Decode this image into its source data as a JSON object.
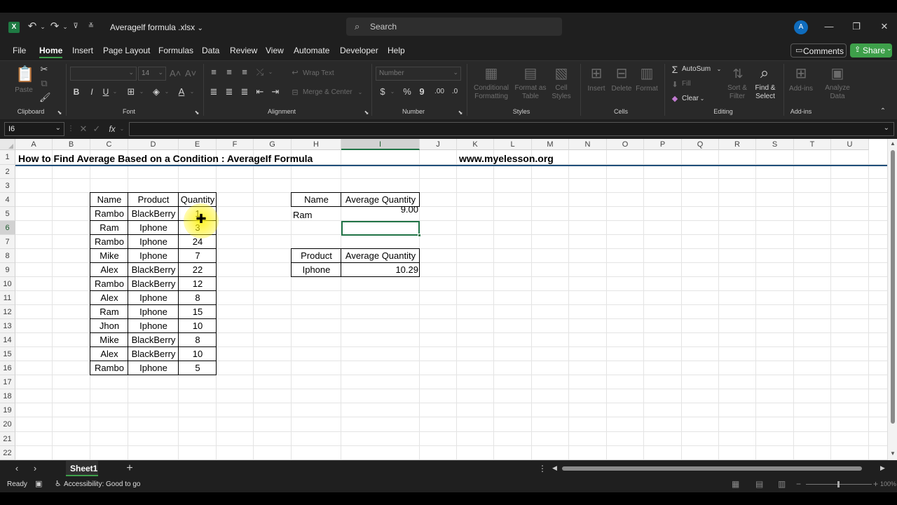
{
  "titlebar": {
    "filename": "Averagelf formula .xlsx",
    "search_placeholder": "Search",
    "avatar_letter": "A"
  },
  "menu": {
    "tabs": [
      "File",
      "Home",
      "Insert",
      "Page Layout",
      "Formulas",
      "Data",
      "Review",
      "View",
      "Automate",
      "Developer",
      "Help"
    ],
    "active": "Home",
    "comments_label": "Comments",
    "share_label": "Share"
  },
  "ribbon": {
    "clipboard": {
      "paste": "Paste",
      "group": "Clipboard"
    },
    "font": {
      "name": "",
      "size": "14",
      "group": "Font"
    },
    "alignment": {
      "wrap": "Wrap Text",
      "merge": "Merge & Center",
      "group": "Alignment"
    },
    "number": {
      "format": "Number",
      "group": "Number"
    },
    "styles": {
      "conditional": "Conditional Formatting",
      "format_table": "Format as Table",
      "cell_styles": "Cell Styles",
      "group": "Styles"
    },
    "cells": {
      "insert": "Insert",
      "delete": "Delete",
      "format": "Format",
      "group": "Cells"
    },
    "editing": {
      "autosum": "AutoSum",
      "fill": "Fill",
      "clear": "Clear",
      "sort": "Sort & Filter",
      "find": "Find & Select",
      "group": "Editing"
    },
    "addins": {
      "addins": "Add-ins",
      "analyze": "Analyze Data",
      "group": "Add-ins"
    }
  },
  "formula_bar": {
    "name_box": "I6",
    "fx": "fx",
    "content": ""
  },
  "grid": {
    "columns": [
      "A",
      "B",
      "C",
      "D",
      "E",
      "F",
      "G",
      "H",
      "I",
      "J",
      "K",
      "L",
      "M",
      "N",
      "O",
      "P",
      "Q",
      "R",
      "S",
      "T",
      "U"
    ],
    "rows": [
      "1",
      "2",
      "3",
      "4",
      "5",
      "6",
      "7",
      "8",
      "9",
      "10",
      "11",
      "12",
      "13",
      "14",
      "15",
      "16",
      "17",
      "18",
      "19",
      "20",
      "21",
      "22"
    ],
    "selected_column": "I",
    "selected_row": "6",
    "title": "How to Find Average Based on a Condition : AverageIf Formula",
    "website": "www.myelesson.org",
    "table_headers": [
      "Name",
      "Product",
      "Quantity"
    ],
    "table_rows": [
      [
        "Rambo",
        "BlackBerry",
        "1"
      ],
      [
        "Ram",
        "Iphone",
        "3"
      ],
      [
        "Rambo",
        "Iphone",
        "24"
      ],
      [
        "Mike",
        "Iphone",
        "7"
      ],
      [
        "Alex",
        "BlackBerry",
        "22"
      ],
      [
        "Rambo",
        "BlackBerry",
        "12"
      ],
      [
        "Alex",
        "Iphone",
        "8"
      ],
      [
        "Ram",
        "Iphone",
        "15"
      ],
      [
        "Jhon",
        "Iphone",
        "10"
      ],
      [
        "Mike",
        "BlackBerry",
        "8"
      ],
      [
        "Alex",
        "BlackBerry",
        "10"
      ],
      [
        "Rambo",
        "Iphone",
        "5"
      ]
    ],
    "avg_name": {
      "header_left": "Name",
      "header_right": "Average Quantity",
      "name": "Ram",
      "value": "9.00"
    },
    "avg_product": {
      "header_left": "Product",
      "header_right": "Average Quantity",
      "product": "Iphone",
      "value": "10.29"
    }
  },
  "sheets": {
    "tabs": [
      "Sheet1"
    ],
    "active": "Sheet1",
    "add": "+"
  },
  "status": {
    "ready": "Ready",
    "accessibility": "Accessibility: Good to go",
    "zoom": "100%"
  },
  "colors": {
    "accent": "#217346",
    "share": "#3ea04a",
    "avatar": "#0f6cbd",
    "highlight": "#fff200"
  }
}
